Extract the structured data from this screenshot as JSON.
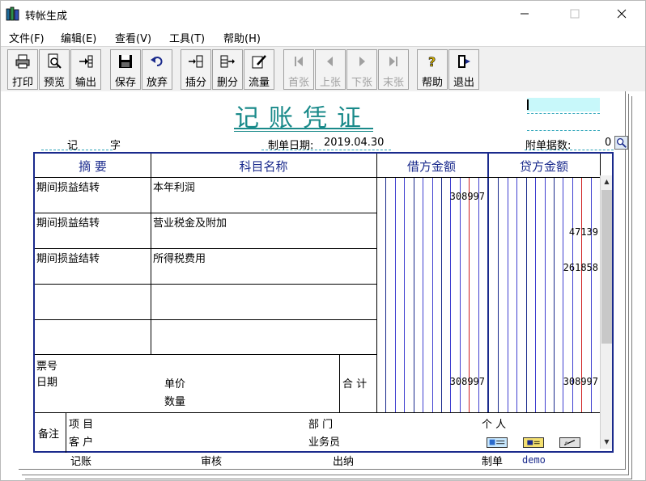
{
  "window": {
    "title": "转帐生成"
  },
  "menu": [
    {
      "label": "文件(F)"
    },
    {
      "label": "编辑(E)"
    },
    {
      "label": "查看(V)"
    },
    {
      "label": "工具(T)"
    },
    {
      "label": "帮助(H)"
    }
  ],
  "toolbar": {
    "print": "打印",
    "preview": "预览",
    "export": "输出",
    "save": "保存",
    "discard": "放弃",
    "insert": "插分",
    "delete": "删分",
    "flow": "流量",
    "first": "首张",
    "prev": "上张",
    "next": "下张",
    "last": "末张",
    "help": "帮助",
    "exit": "退出"
  },
  "voucher": {
    "title": "记账凭证",
    "type_label": "记",
    "type_suffix": "字",
    "date_label": "制单日期:",
    "date_value": "2019.04.30",
    "attach_label": "附单据数:",
    "attach_value": "0",
    "headers": {
      "summary": "摘 要",
      "account": "科目名称",
      "debit": "借方金额",
      "credit": "贷方金额"
    },
    "rows": [
      {
        "summary": "期间损益结转",
        "account": "本年利润",
        "debit": "308997",
        "credit": ""
      },
      {
        "summary": "期间损益结转",
        "account": "营业税金及附加",
        "debit": "",
        "credit": "47139"
      },
      {
        "summary": "期间损益结转",
        "account": "所得税费用",
        "debit": "",
        "credit": "261858"
      },
      {
        "summary": "",
        "account": "",
        "debit": "",
        "credit": ""
      },
      {
        "summary": "",
        "account": "",
        "debit": "",
        "credit": ""
      }
    ],
    "footer": {
      "ticket_no": "票号",
      "date": "日期",
      "unit_price": "单价",
      "quantity": "数量",
      "total_label": "合 计",
      "total_debit": "308997",
      "total_credit": "308997"
    },
    "remarks": {
      "label": "备注",
      "project": "项   目",
      "customer": "客   户",
      "department": "部   门",
      "salesman": "业务员",
      "individual": "个   人"
    },
    "signatures": {
      "bookkeeping": "记账",
      "review": "审核",
      "cashier": "出纳",
      "maker_label": "制单",
      "maker_value": "demo"
    }
  }
}
